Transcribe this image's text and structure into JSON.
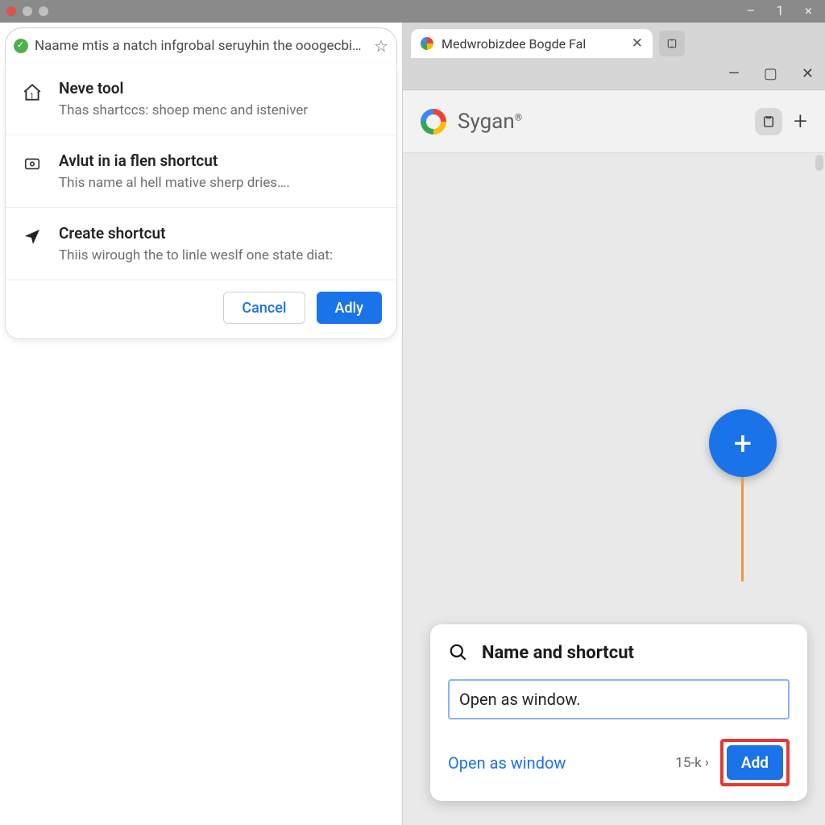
{
  "window": {
    "title_hint": "1",
    "controls": {
      "min": "–",
      "max": "▢",
      "close": "×"
    }
  },
  "left": {
    "omnibox_text": "Naame mtis a natch infgrobal seruyhin the ooogecbign…",
    "rows": [
      {
        "title": "Neve tool",
        "desc": "Thas shartccs: shoep menc and isteniver"
      },
      {
        "title": "Avlut in ia flen shortcut",
        "desc": "This name al hell mative sherp dries…."
      },
      {
        "title": "Create shortcut",
        "desc": "Thiis wirough the to linle weslf one state diat:"
      }
    ],
    "buttons": {
      "cancel": "Cancel",
      "confirm": "Adly"
    }
  },
  "right": {
    "tab_label": "Medwrobizdee Bogde Fal",
    "brand": "Sygan",
    "brand_sup": "®",
    "dialog": {
      "title": "Name and shortcut",
      "input_value": "Open as window.",
      "link": "Open as window",
      "meta": "15-k",
      "add": "Add"
    }
  }
}
